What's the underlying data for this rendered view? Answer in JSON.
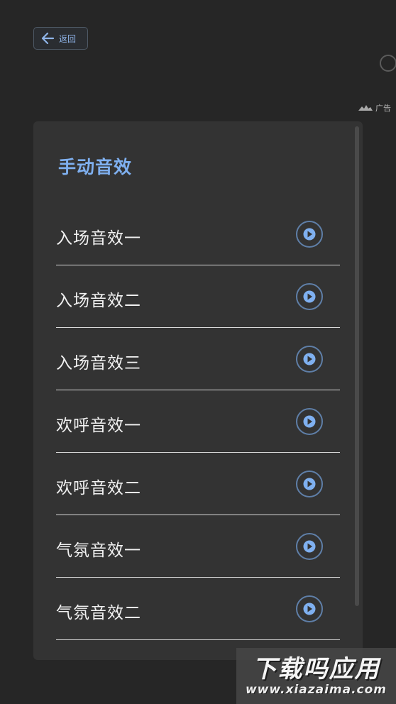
{
  "header": {
    "back_label": "返回"
  },
  "ad": {
    "label": "广告"
  },
  "panel": {
    "title": "手动音效",
    "items": [
      {
        "label": "入场音效一"
      },
      {
        "label": "入场音效二"
      },
      {
        "label": "入场音效三"
      },
      {
        "label": "欢呼音效一"
      },
      {
        "label": "欢呼音效二"
      },
      {
        "label": "气氛音效一"
      },
      {
        "label": "气氛音效二"
      }
    ]
  },
  "watermark": {
    "title": "下载吗应用",
    "url": "www.xiazaima.com"
  },
  "colors": {
    "accent": "#7fb0f0",
    "background": "#262626",
    "panel": "#333333"
  }
}
